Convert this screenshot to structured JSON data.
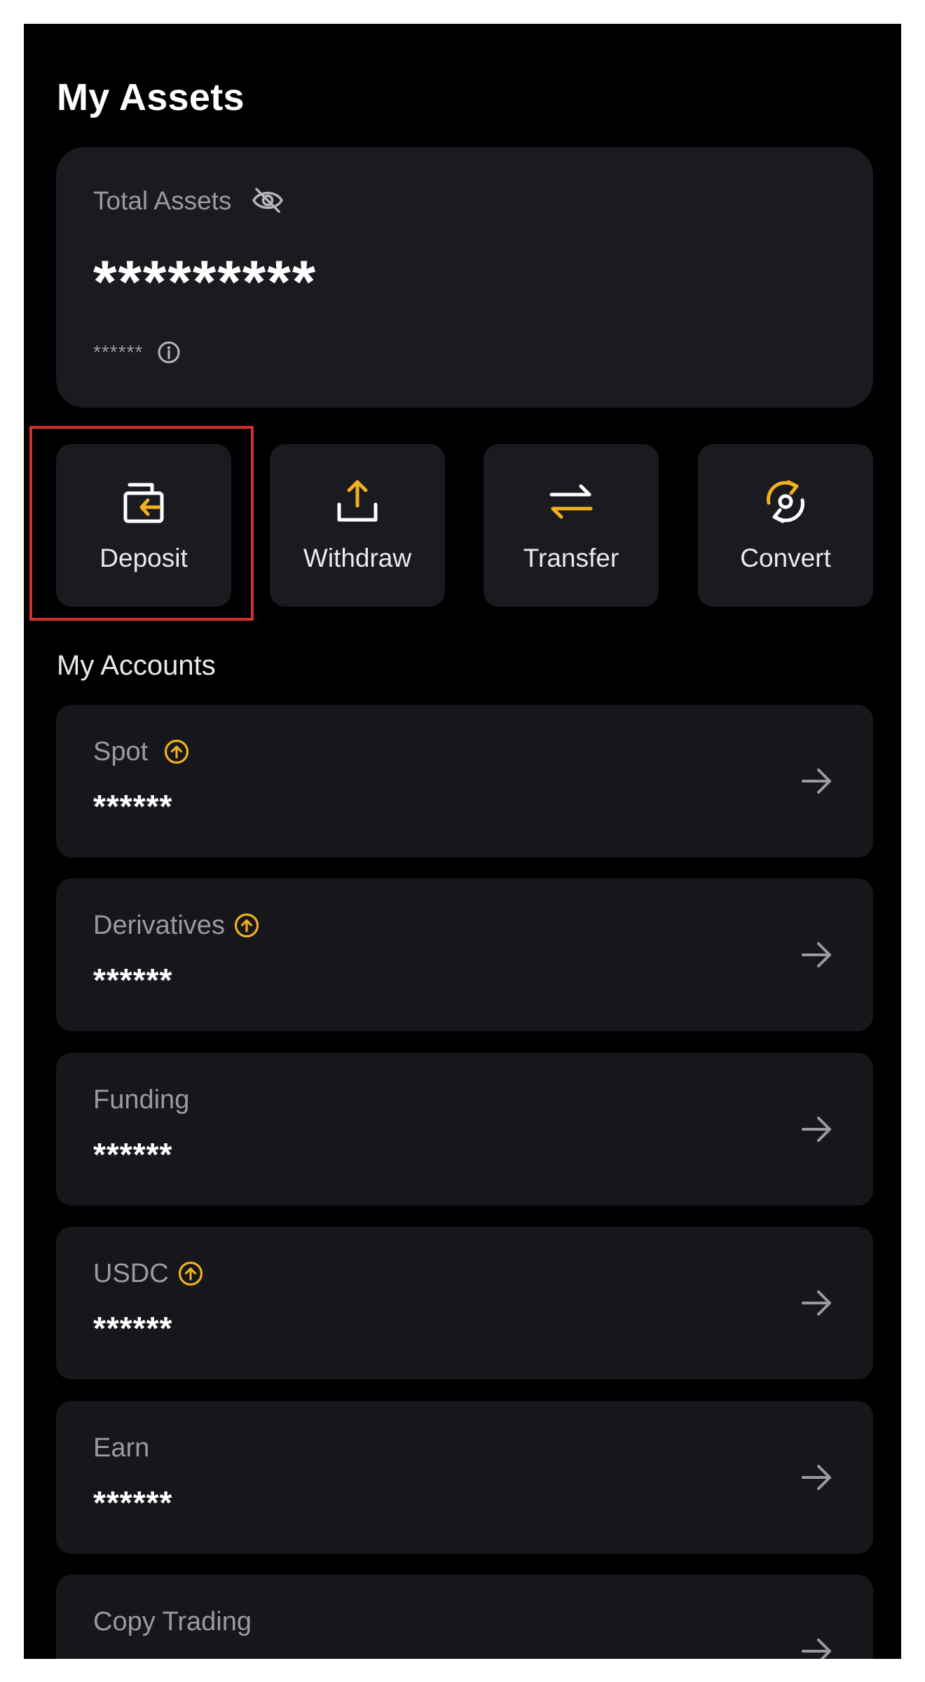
{
  "page": {
    "title": "My Assets"
  },
  "total": {
    "label": "Total Assets",
    "value": "*********",
    "sub_value": "******"
  },
  "actions": [
    {
      "label": "Deposit",
      "icon": "wallet-in-icon",
      "highlighted": true
    },
    {
      "label": "Withdraw",
      "icon": "upload-icon",
      "highlighted": false
    },
    {
      "label": "Transfer",
      "icon": "swap-arrows-icon",
      "highlighted": false
    },
    {
      "label": "Convert",
      "icon": "convert-cycle-icon",
      "highlighted": false
    }
  ],
  "accounts_section": {
    "title": "My Accounts"
  },
  "accounts": [
    {
      "name": "Spot",
      "value": "******",
      "upgrade_badge": true
    },
    {
      "name": "Derivatives",
      "value": "******",
      "upgrade_badge": true
    },
    {
      "name": "Funding",
      "value": "******",
      "upgrade_badge": false
    },
    {
      "name": "USDC",
      "value": "******",
      "upgrade_badge": true
    },
    {
      "name": "Earn",
      "value": "******",
      "upgrade_badge": false
    },
    {
      "name": "Copy Trading",
      "value": "",
      "upgrade_badge": false
    }
  ],
  "colors": {
    "accent": "#f0b020",
    "card_background": "#1a1b20",
    "highlight_border": "#d3302d"
  }
}
